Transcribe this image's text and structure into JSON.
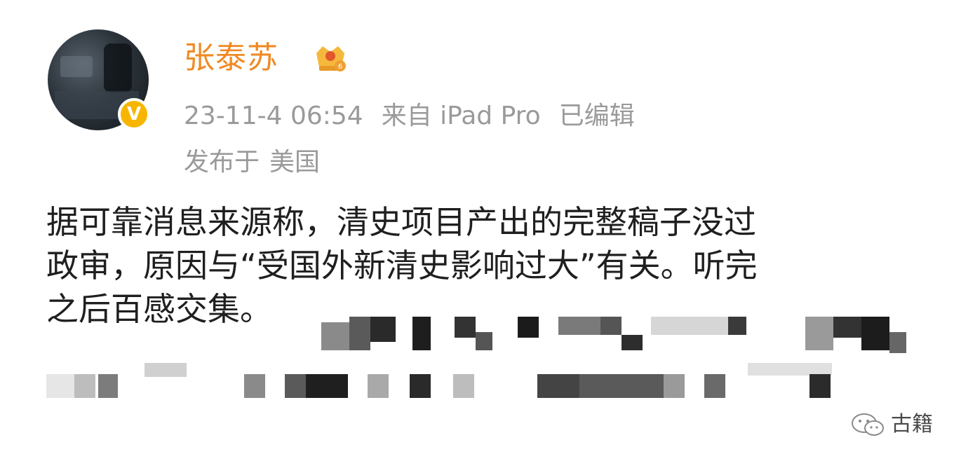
{
  "post": {
    "username": "张泰苏",
    "timestamp": "23-11-4 06:54",
    "source": "来自 iPad Pro",
    "edited": "已编辑",
    "location_prefix": "发布于",
    "location": "美国",
    "lines": [
      "据可靠消息来源称，清史项目产出的完整稿子没过",
      "政审，原因与“受国外新清史影响过大”有关。听完",
      "之后百感交集。"
    ]
  },
  "icons": {
    "avatar": "user-avatar",
    "verified_badge": "verified-v-icon",
    "member_badge": "crown-icon",
    "watermark": "wechat-icon"
  },
  "badge": {
    "verified_letter": "V"
  },
  "watermark": {
    "text": "古籍"
  },
  "colors": {
    "username": "#f08a24",
    "meta": "#9a9a9a",
    "body": "#1f1f1f",
    "verified": "#f7b500"
  }
}
